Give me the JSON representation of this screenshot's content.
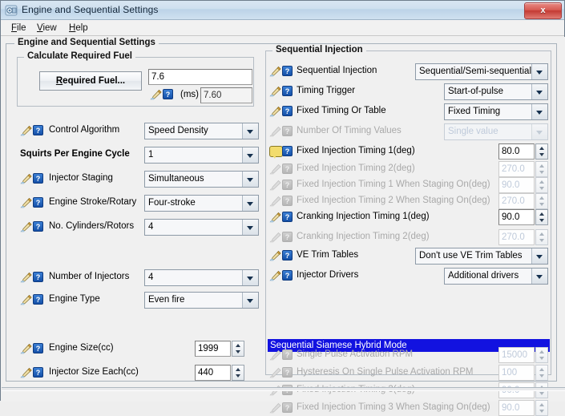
{
  "window": {
    "title": "Engine and Sequential Settings",
    "app_icon": "engine-settings-icon",
    "close_label": "x"
  },
  "menubar": {
    "items": [
      {
        "label": "File",
        "mnemonic": "F"
      },
      {
        "label": "View",
        "mnemonic": "V"
      },
      {
        "label": "Help",
        "mnemonic": "H"
      }
    ]
  },
  "panels": {
    "outer_title": "Engine and Sequential Settings",
    "fuel_group_title": "Calculate Required Fuel",
    "sequential_group_title": "Sequential Injection"
  },
  "fuel_group": {
    "button_label": "Required Fuel...",
    "button_mnemonic": "R",
    "input_value": "7.6",
    "units_label": "(ms)",
    "computed_value": "7.60"
  },
  "left_rows": [
    {
      "label": "Control Algorithm",
      "value": "Speed Density",
      "widget": "combo",
      "icons": "pencil-help",
      "bold": false,
      "disabled": false
    },
    {
      "label": "Squirts Per Engine Cycle",
      "value": "1",
      "widget": "combo",
      "icons": "none",
      "bold": true,
      "disabled": false
    },
    {
      "label": "Injector Staging",
      "value": "Simultaneous",
      "widget": "combo",
      "icons": "pencil-help",
      "bold": false,
      "disabled": false
    },
    {
      "label": "Engine Stroke/Rotary",
      "value": "Four-stroke",
      "widget": "combo",
      "icons": "pencil-help",
      "bold": false,
      "disabled": false
    },
    {
      "label": "No. Cylinders/Rotors",
      "value": "4",
      "widget": "combo",
      "icons": "pencil-help",
      "bold": false,
      "disabled": false
    },
    {
      "label": "Number of Injectors",
      "value": "4",
      "widget": "combo",
      "icons": "pencil-help",
      "bold": false,
      "disabled": false
    },
    {
      "label": "Engine Type",
      "value": "Even fire",
      "widget": "combo",
      "icons": "pencil-help",
      "bold": false,
      "disabled": false
    },
    {
      "label": "Engine Size(cc)",
      "value": "1999",
      "widget": "spinner",
      "icons": "pencil-help",
      "bold": false,
      "disabled": false
    },
    {
      "label": "Injector Size Each(cc)",
      "value": "440",
      "widget": "spinner",
      "icons": "pencil-help",
      "bold": false,
      "disabled": false
    }
  ],
  "right_rows": [
    {
      "label": "Sequential Injection",
      "value": "Sequential/Semi-sequential",
      "widget": "combo",
      "icons": "pencil-help",
      "disabled": false
    },
    {
      "label": "Timing Trigger",
      "value": "Start-of-pulse",
      "widget": "combo",
      "icons": "pencil-help",
      "disabled": false
    },
    {
      "label": "Fixed Timing Or Table",
      "value": "Fixed Timing",
      "widget": "combo",
      "icons": "pencil-help",
      "disabled": false
    },
    {
      "label": "Number Of Timing Values",
      "value": "Single value",
      "widget": "combo",
      "icons": "pencil-help",
      "disabled": true
    },
    {
      "label": "Fixed Injection Timing 1(deg)",
      "value": "80.0",
      "widget": "spinner",
      "icons": "bubble-help",
      "disabled": false
    },
    {
      "label": "Fixed Injection Timing 2(deg)",
      "value": "270.0",
      "widget": "spinner",
      "icons": "pencil-help",
      "disabled": true
    },
    {
      "label": "Fixed Injection Timing 1 When Staging On(deg)",
      "value": "90.0",
      "widget": "spinner",
      "icons": "pencil-help",
      "disabled": true
    },
    {
      "label": "Fixed Injection Timing 2 When Staging On(deg)",
      "value": "270.0",
      "widget": "spinner",
      "icons": "pencil-help",
      "disabled": true
    },
    {
      "label": "Cranking Injection Timing 1(deg)",
      "value": "90.0",
      "widget": "spinner",
      "icons": "pencil-help",
      "disabled": false
    },
    {
      "label": "Cranking Injection Timing 2(deg)",
      "value": "270.0",
      "widget": "spinner",
      "icons": "pencil-help",
      "disabled": true
    },
    {
      "label": "VE Trim Tables",
      "value": "Don't use VE Trim Tables",
      "widget": "combo",
      "icons": "pencil-help",
      "disabled": false
    },
    {
      "label": "Injector Drivers",
      "value": "Additional drivers",
      "widget": "combo",
      "icons": "pencil-help",
      "disabled": false
    }
  ],
  "hybrid_section": {
    "header": "Sequential Siamese Hybrid Mode",
    "rows": [
      {
        "label": "Single Pulse Activation RPM",
        "value": "15000",
        "widget": "spinner",
        "icons": "pencil-help",
        "disabled": true
      },
      {
        "label": "Hysteresis On Single Pulse Activation RPM",
        "value": "100",
        "widget": "spinner",
        "icons": "pencil-help",
        "disabled": true
      },
      {
        "label": "Fixed Injection Timing 3(deg)",
        "value": "90.0",
        "widget": "spinner",
        "icons": "pencil-help",
        "disabled": true
      },
      {
        "label": "Fixed Injection Timing 3 When Staging On(deg)",
        "value": "90.0",
        "widget": "spinner",
        "icons": "pencil-help",
        "disabled": true
      }
    ]
  },
  "colors": {
    "selection_blue": "#1212e0",
    "close_red": "#c33a33",
    "help_icon_blue": "#1450a8",
    "bubble_yellow": "#f2dc6d",
    "panel_bg": "#f0f0f0",
    "disabled_text": "#a9a9a9"
  }
}
